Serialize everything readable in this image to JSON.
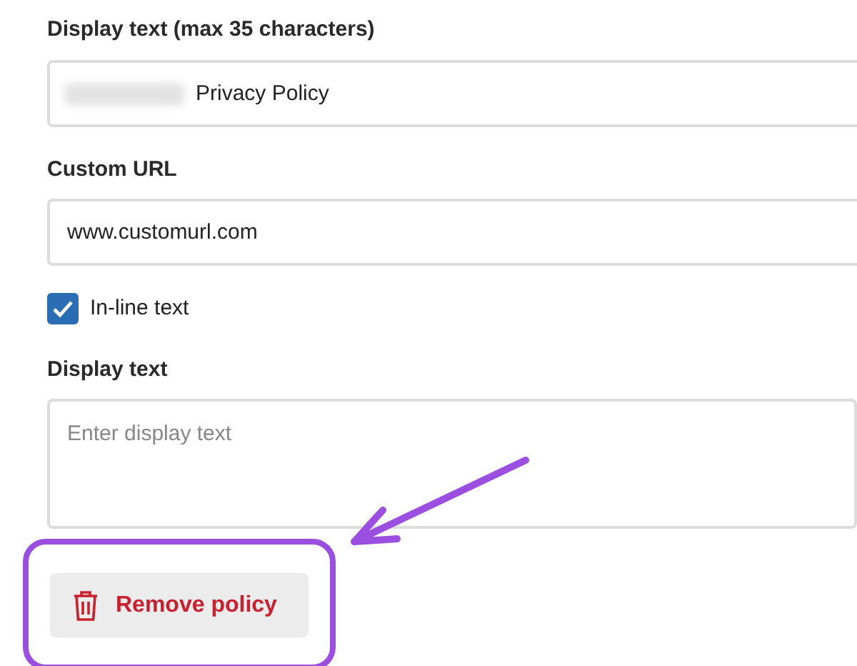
{
  "fields": [
    {
      "kind": "input",
      "label": "Display text (max 35 characters)",
      "value": "Privacy Policy",
      "redacted_prefix": true
    },
    {
      "kind": "input",
      "label": "Custom URL",
      "value": "www.customurl.com"
    },
    {
      "kind": "checkbox",
      "label": "In-line text",
      "checked": true
    },
    {
      "kind": "textarea",
      "label": "Display text",
      "placeholder": "Enter display text"
    }
  ],
  "button": {
    "label": "Remove policy",
    "highlighted": true
  }
}
